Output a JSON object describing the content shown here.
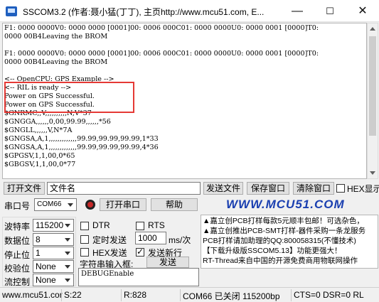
{
  "window": {
    "title": "SSCOM3.2 (作者:聂小猛(丁丁), 主页http://www.mcu51.com, E...",
    "minimize": "—",
    "maximize": "☐",
    "close": "✕"
  },
  "receive": {
    "lines": [
      "F1: 0000 0000V0: 0000 0000 [0001]00: 0006 000C01: 0000 0000U0: 0000 0001 [0000]T0:",
      "0000 00B4Leaving the BROM",
      "",
      "F1: 0000 0000V0: 0000 0000 [0001]00: 0006 000C01: 0000 0000U0: 0000 0001 [0000]T0:",
      "0000 00B4Leaving the BROM",
      "",
      "<-- OpenCPU: GPS Example -->",
      "<-- RIL is ready -->",
      "Power on GPS Successful.",
      "Power on GPS Successful.",
      "$GNRMC,,V,,,,,,,,,,N,V*37",
      "$GNGGA,,,,,,0,00,99.99,,,,,,*56",
      "$GNGLL,,,,,,V,N*7A",
      "$GNGSA,A,1,,,,,,,,,,,,,99.99,99.99,99.99,1*33",
      "$GNGSA,A,1,,,,,,,,,,,,,99.99,99.99,99.99,4*36",
      "$GPGSV,1,1,00,0*65",
      "$GBGSV,1,1,00,0*77"
    ]
  },
  "file_row": {
    "open_file": "打开文件",
    "file_name": "文件名",
    "send_file": "发送文件",
    "save_window": "保存窗口",
    "clear_window": "清除窗口",
    "hex_display": "HEX显示"
  },
  "port_row": {
    "port_label": "串口号",
    "port_value": "COM66",
    "open_port": "打开串口",
    "help": "帮助",
    "website": "WWW.MCU51.COM"
  },
  "settings": {
    "baud_label": "波特率",
    "baud_value": "115200",
    "data_label": "数据位",
    "data_value": "8",
    "stop_label": "停止位",
    "stop_value": "1",
    "parity_label": "校验位",
    "parity_value": "None",
    "flow_label": "流控制",
    "flow_value": "None"
  },
  "options": {
    "dtr": "DTR",
    "rts": "RTS",
    "timed_send": "定时发送",
    "interval": "1000",
    "interval_unit": "ms/次",
    "hex_send": "HEX发送",
    "send_newline": "发送新行",
    "input_label": "字符串输入框:",
    "send": "发送",
    "send_text": "DEBUGEnable"
  },
  "ads": [
    "▲嘉立创PCB打样每款5元顺丰包邮！可选杂色，",
    "▲嘉立创推出PCB-SMT打样-器件采购一条龙服务",
    "PCB打样请加助理的QQ:800058315(不懂技术)",
    "【下载升级版SSCOM5.13】功能更强大！",
    "RT-Thread来自中国的开源免费商用物联网操作"
  ],
  "status": {
    "site": "www.mcu51.cor",
    "sent": "S:22",
    "received": "R:828",
    "port_state": "COM66 已关闭  115200bp",
    "lines_state": "CTS=0 DSR=0 RL"
  },
  "colors": {
    "highlight": "#e53935",
    "website": "#1a3fb0",
    "led": "#c62828"
  },
  "icons": {
    "app": "sscom-app-icon",
    "led": "port-status-led"
  }
}
